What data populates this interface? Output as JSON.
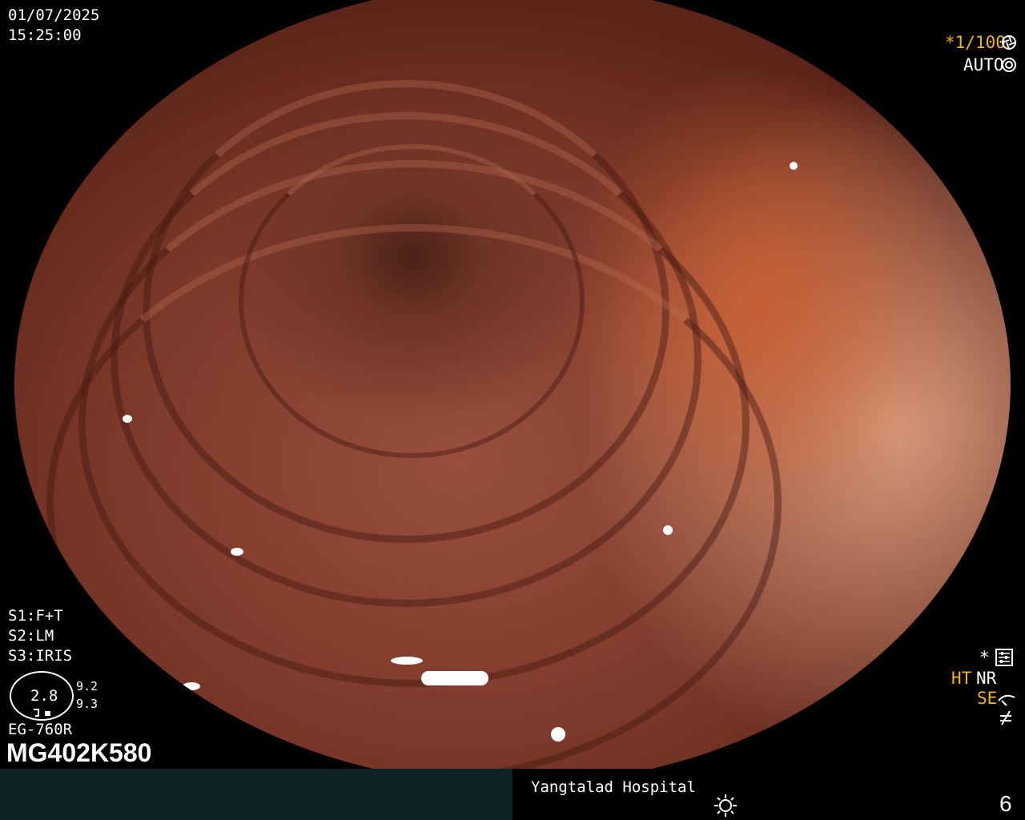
{
  "header": {
    "date": "01/07/2025",
    "time": "15:25:00"
  },
  "top_right": {
    "shutter_speed": "*1/100",
    "shutter_icon": "shutter-icon",
    "iris_mode": "AUTO",
    "iris_icon": "iris-icon"
  },
  "left_panel": {
    "s1": "S1:F+T",
    "s2": "S2:LM",
    "s3": "S3:IRIS",
    "zoom_value": "2.8",
    "zoom_side_top": "9.2",
    "zoom_side_bottom": "9.3",
    "scope_model": "EG-760R",
    "serial": "MG402K580"
  },
  "right_panel": {
    "star": "*",
    "settings_icon": "settings-icon",
    "ht": "HT",
    "nr": "NR",
    "se": "SE",
    "se_icon": "structure-enhancement-icon",
    "freeze_icon": "freeze-icon"
  },
  "footer": {
    "hospital": "Yangtalad Hospital",
    "brightness_icon": "brightness-icon",
    "page_number": "6"
  },
  "colors": {
    "background": "#000000",
    "footer_left_bg": "#0d2224",
    "yellow": "#f2b21b",
    "text": "#ffffff"
  }
}
